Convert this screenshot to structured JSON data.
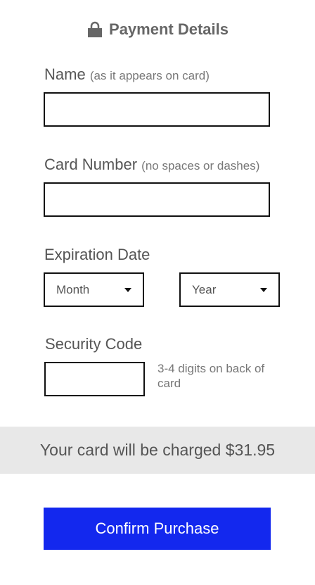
{
  "header": {
    "icon": "lock-icon",
    "title": "Payment Details"
  },
  "name_field": {
    "label": "Name",
    "hint": "(as it appears on card)",
    "value": ""
  },
  "card_number_field": {
    "label": "Card Number",
    "hint": "(no spaces or dashes)",
    "value": ""
  },
  "expiration": {
    "label": "Expiration Date",
    "month_selected": "Month",
    "year_selected": "Year"
  },
  "security_code": {
    "label": "Security Code",
    "value": "",
    "hint": "3-4 digits on back of card"
  },
  "charge_banner": {
    "text": "Your card will be charged $31.95"
  },
  "confirm_button": {
    "label": "Confirm Purchase",
    "color": "#1328ee"
  }
}
